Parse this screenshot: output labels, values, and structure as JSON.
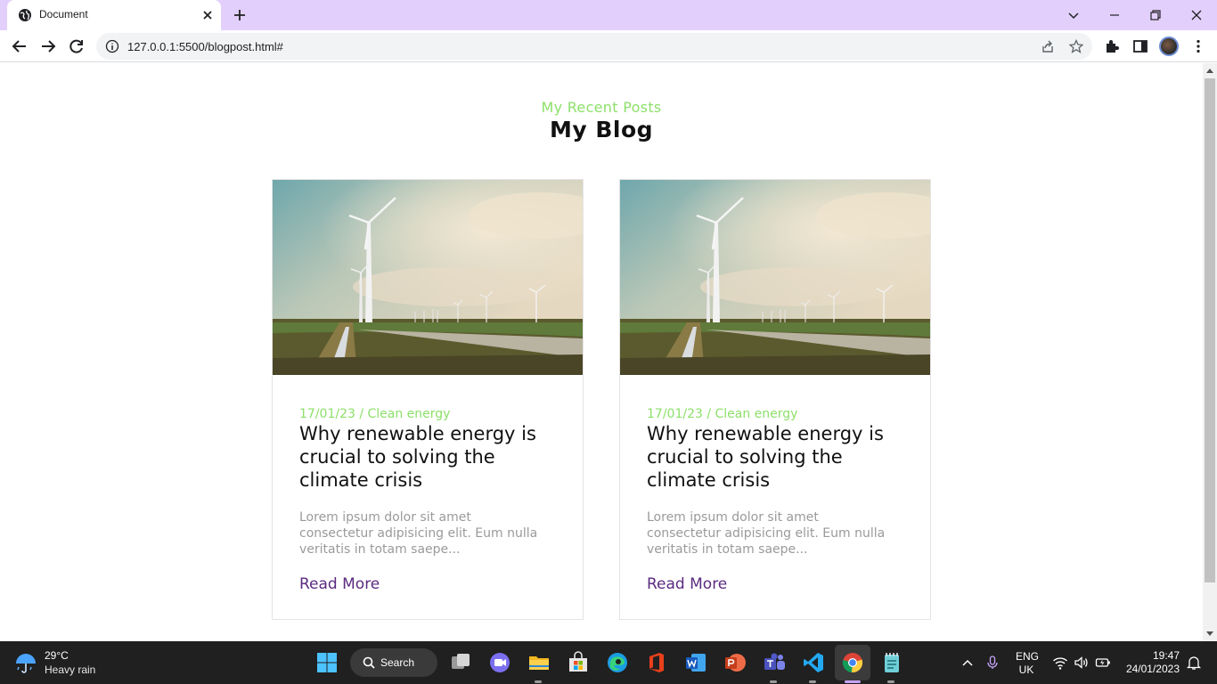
{
  "browser": {
    "tab": {
      "title": "Document"
    },
    "url": "127.0.0.1:5500/blogpost.html#"
  },
  "page": {
    "subtitle": "My Recent Posts",
    "title": "My Blog",
    "posts": [
      {
        "meta": "17/01/23 / Clean energy",
        "title": "Why renewable energy is crucial to solving the climate crisis",
        "excerpt": "Lorem ipsum dolor sit amet consectetur adipisicing elit. Eum nulla veritatis in totam saepe...",
        "read_more": "Read More"
      },
      {
        "meta": "17/01/23 / Clean energy",
        "title": "Why renewable energy is crucial to solving the climate crisis",
        "excerpt": "Lorem ipsum dolor sit amet consectetur adipisicing elit. Eum nulla veritatis in totam saepe...",
        "read_more": "Read More"
      }
    ]
  },
  "taskbar": {
    "weather": {
      "temp": "29°C",
      "desc": "Heavy rain"
    },
    "search_label": "Search",
    "lang": {
      "line1": "ENG",
      "line2": "UK"
    },
    "time": "19:47",
    "date": "24/01/2023"
  },
  "colors": {
    "accent_green": "#8de06a",
    "link_purple": "#5a2a80",
    "tabstrip": "#e3cffb"
  }
}
